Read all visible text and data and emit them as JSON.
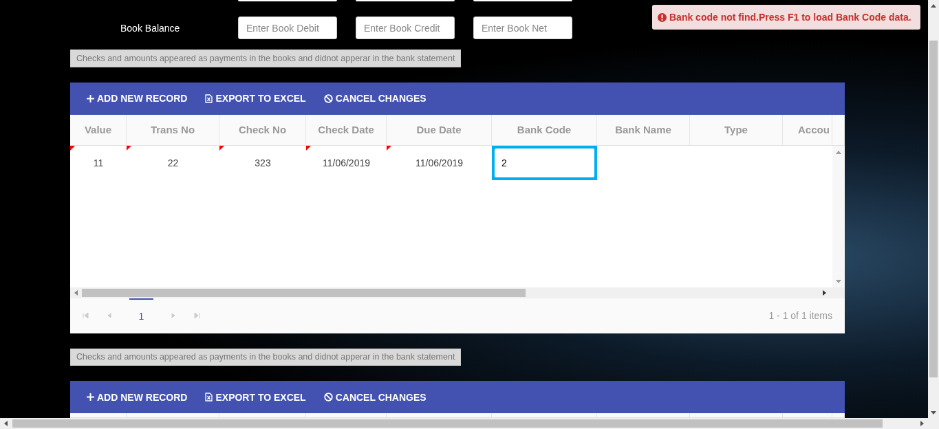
{
  "book_balance": {
    "label": "Book Balance",
    "fields": [
      {
        "placeholder": "Enter Book Debit"
      },
      {
        "placeholder": "Enter Book Credit"
      },
      {
        "placeholder": "Enter Book Net"
      }
    ]
  },
  "alert": {
    "text": "Bank code not find.Press F1 to load Bank Code data."
  },
  "sections": [
    {
      "caption": "Checks and amounts appeared as payments in the books and didnot apperar in the bank statement",
      "toolbar": [
        {
          "kind": "add",
          "label": "ADD NEW RECORD"
        },
        {
          "kind": "export",
          "label": "EXPORT TO EXCEL"
        },
        {
          "kind": "cancel",
          "label": "CANCEL CHANGES"
        }
      ],
      "columns": [
        "Value",
        "Trans No",
        "Check No",
        "Check Date",
        "Due Date",
        "Bank Code",
        "Bank Name",
        "Type",
        "Accou"
      ],
      "rows": [
        {
          "cells": [
            {
              "value": "11",
              "dirty": true,
              "editing": false
            },
            {
              "value": "22",
              "dirty": true,
              "editing": false
            },
            {
              "value": "323",
              "dirty": true,
              "editing": false
            },
            {
              "value": "11/06/2019",
              "dirty": true,
              "editing": false
            },
            {
              "value": "11/06/2019",
              "dirty": true,
              "editing": false
            },
            {
              "value": "2",
              "dirty": false,
              "editing": true
            }
          ]
        }
      ],
      "pager": {
        "pages": [
          {
            "label": "1",
            "selected": true
          }
        ],
        "info": "1 - 1 of 1 items"
      }
    },
    {
      "caption": "Checks and amounts appeared as payments in the books and didnot apperar in the bank statement",
      "toolbar": [
        {
          "kind": "add",
          "label": "ADD NEW RECORD"
        },
        {
          "kind": "export",
          "label": "EXPORT TO EXCEL"
        },
        {
          "kind": "cancel",
          "label": "CANCEL CHANGES"
        }
      ]
    }
  ]
}
